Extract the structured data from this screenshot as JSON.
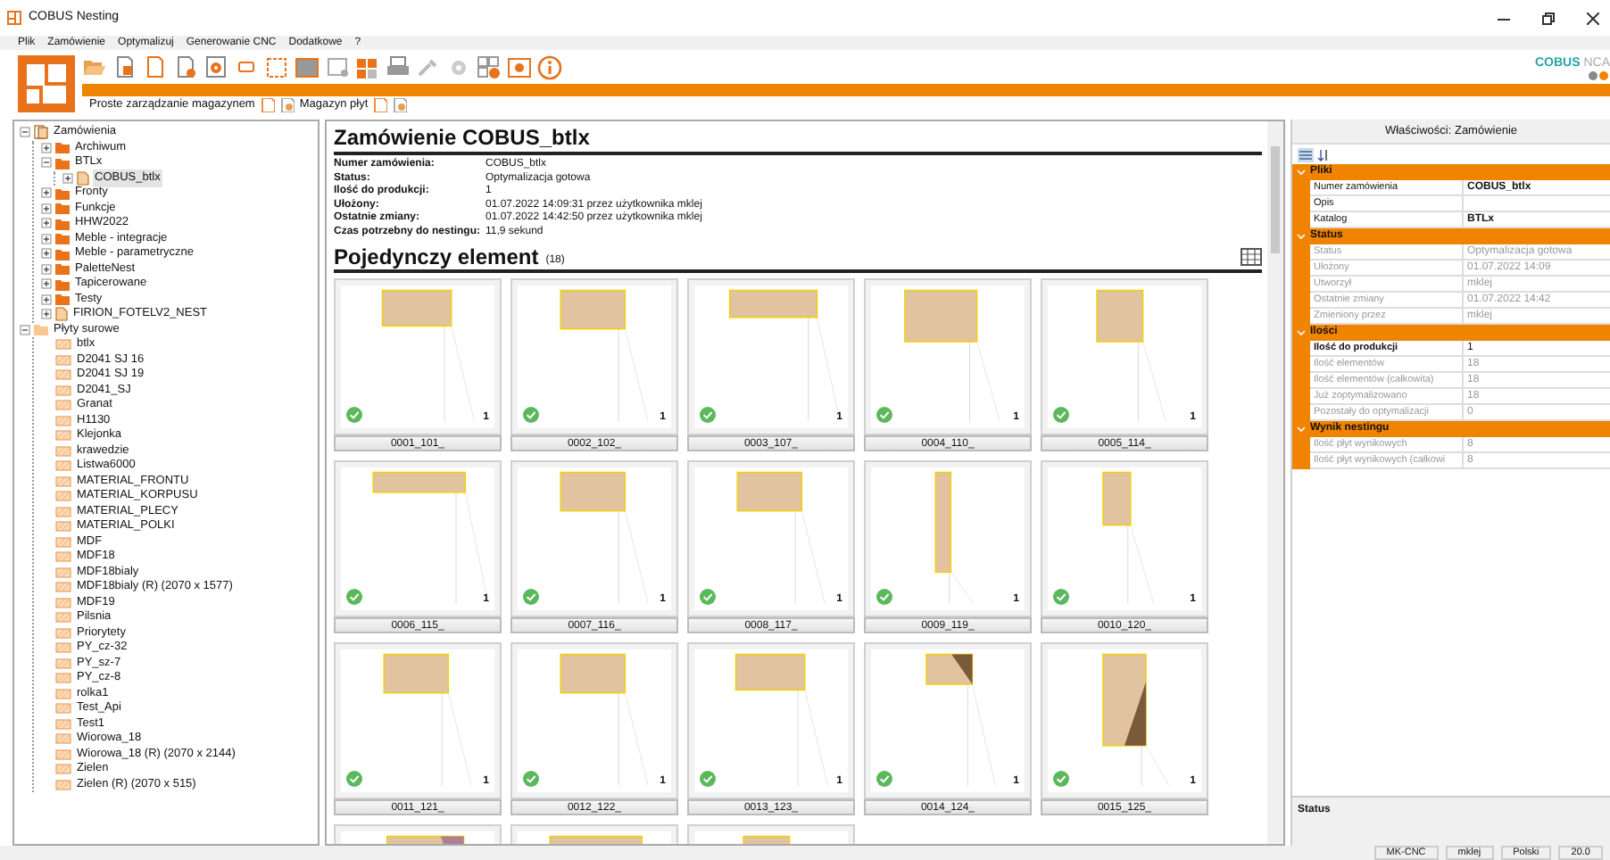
{
  "window": {
    "title": "COBUS Nesting"
  },
  "menu": [
    "Plik",
    "Zamówienie",
    "Optymalizuj",
    "Generowanie CNC",
    "Dodatkowe",
    "?"
  ],
  "brand": {
    "primary": "COBUS",
    "secondary": "NCA"
  },
  "subtoolbar": [
    {
      "label": "Proste zarządzanie magazynem"
    },
    {
      "label": "Magazyn płyt"
    }
  ],
  "tree": [
    {
      "label": "Zamówienia",
      "kind": "orders",
      "expanded": true,
      "selected": false,
      "children": [
        {
          "label": "Archiwum",
          "kind": "folder",
          "expanded": false,
          "selected": false
        },
        {
          "label": "BTLx",
          "kind": "folder",
          "expanded": true,
          "selected": false,
          "children": [
            {
              "label": "COBUS_btlx",
              "kind": "order",
              "expanded": false,
              "selected": true
            }
          ]
        },
        {
          "label": "Fronty",
          "kind": "folder",
          "expanded": false,
          "selected": false
        },
        {
          "label": "Funkcje",
          "kind": "folder",
          "expanded": false,
          "selected": false
        },
        {
          "label": "HHW2022",
          "kind": "folder",
          "expanded": false,
          "selected": false
        },
        {
          "label": "Meble - integracje",
          "kind": "folder",
          "expanded": false,
          "selected": false
        },
        {
          "label": "Meble - parametryczne",
          "kind": "folder",
          "expanded": false,
          "selected": false
        },
        {
          "label": "PaletteNest",
          "kind": "folder",
          "expanded": false,
          "selected": false
        },
        {
          "label": "Tapicerowane",
          "kind": "folder",
          "expanded": false,
          "selected": false
        },
        {
          "label": "Testy",
          "kind": "folder",
          "expanded": false,
          "selected": false
        },
        {
          "label": "FIRION_FOTELV2_NEST",
          "kind": "order",
          "expanded": false,
          "selected": false
        }
      ]
    },
    {
      "label": "Płyty surowe",
      "kind": "plates",
      "expanded": true,
      "selected": false,
      "children": [
        {
          "label": "btlx",
          "kind": "plate",
          "selected": false
        },
        {
          "label": "D2041 SJ 16",
          "kind": "plate",
          "selected": false
        },
        {
          "label": "D2041 SJ 19",
          "kind": "plate",
          "selected": false
        },
        {
          "label": "D2041_SJ",
          "kind": "plate",
          "selected": false
        },
        {
          "label": "Granat",
          "kind": "plate",
          "selected": false
        },
        {
          "label": "H1130",
          "kind": "plate",
          "selected": false
        },
        {
          "label": "Klejonka",
          "kind": "plate",
          "selected": false
        },
        {
          "label": "krawedzie",
          "kind": "plate",
          "selected": false
        },
        {
          "label": "Listwa6000",
          "kind": "plate",
          "selected": false
        },
        {
          "label": "MATERIAL_FRONTU",
          "kind": "plate",
          "selected": false
        },
        {
          "label": "MATERIAL_KORPUSU",
          "kind": "plate",
          "selected": false
        },
        {
          "label": "MATERIAL_PLECY",
          "kind": "plate",
          "selected": false
        },
        {
          "label": "MATERIAL_POLKI",
          "kind": "plate",
          "selected": false
        },
        {
          "label": "MDF",
          "kind": "plate",
          "selected": false
        },
        {
          "label": "MDF18",
          "kind": "plate",
          "selected": false
        },
        {
          "label": "MDF18bialy",
          "kind": "plate",
          "selected": false
        },
        {
          "label": "MDF18bialy (R) (2070 x 1577)",
          "kind": "plate",
          "selected": false
        },
        {
          "label": "MDF19",
          "kind": "plate",
          "selected": false
        },
        {
          "label": "Pilsnia",
          "kind": "plate",
          "selected": false
        },
        {
          "label": "Priorytety",
          "kind": "plate",
          "selected": false
        },
        {
          "label": "PY_cz-32",
          "kind": "plate",
          "selected": false
        },
        {
          "label": "PY_sz-7",
          "kind": "plate",
          "selected": false
        },
        {
          "label": "PY_cz-8",
          "kind": "plate",
          "selected": false
        },
        {
          "label": "rolka1",
          "kind": "plate",
          "selected": false
        },
        {
          "label": "Test_Api",
          "kind": "plate",
          "selected": false
        },
        {
          "label": "Test1",
          "kind": "plate",
          "selected": false
        },
        {
          "label": "Wiorowa_18",
          "kind": "plate",
          "selected": false
        },
        {
          "label": "Wiorowa_18 (R) (2070 x 2144)",
          "kind": "plate",
          "selected": false
        },
        {
          "label": "Zielen",
          "kind": "plate",
          "selected": false
        },
        {
          "label": "Zielen (R) (2070 x 515)",
          "kind": "plate",
          "selected": false
        }
      ]
    }
  ],
  "order": {
    "title": "Zamówienie COBUS_btlx",
    "fields": [
      {
        "label": "Numer zamówienia:",
        "value": "COBUS_btlx"
      },
      {
        "label": "Status:",
        "value": "Optymalizacja gotowa"
      },
      {
        "label": "Ilość do produkcji:",
        "value": "1"
      },
      {
        "label": "Ułożony:",
        "value": "01.07.2022 14:09:31 przez użytkownika mklej"
      },
      {
        "label": "Ostatnie zmiany:",
        "value": "01.07.2022 14:42:50 przez użytkownika mklej"
      },
      {
        "label": "Czas potrzebny do nestingu:",
        "value": "11,9 sekund"
      }
    ],
    "section": "Pojedynczy element",
    "section_count": "(18)"
  },
  "elements": [
    {
      "name": "0001_101_",
      "count": "1",
      "done": true,
      "kind": "wide"
    },
    {
      "name": "0002_102_",
      "count": "1",
      "done": true,
      "kind": "medium"
    },
    {
      "name": "0003_107_",
      "count": "1",
      "done": true,
      "kind": "broad"
    },
    {
      "name": "0004_110_",
      "count": "1",
      "done": true,
      "kind": "deep"
    },
    {
      "name": "0005_114_",
      "count": "1",
      "done": true,
      "kind": "slim"
    },
    {
      "name": "0006_115_",
      "count": "1",
      "done": true,
      "kind": "flat"
    },
    {
      "name": "0007_116_",
      "count": "1",
      "done": true,
      "kind": "medium"
    },
    {
      "name": "0008_117_",
      "count": "1",
      "done": true,
      "kind": "medium"
    },
    {
      "name": "0009_119_",
      "count": "1",
      "done": true,
      "kind": "narrow"
    },
    {
      "name": "0010_120_",
      "count": "1",
      "done": true,
      "kind": "strip"
    },
    {
      "name": "0011_121_",
      "count": "1",
      "done": true,
      "kind": "medium"
    },
    {
      "name": "0012_122_",
      "count": "1",
      "done": true,
      "kind": "medium"
    },
    {
      "name": "0013_123_",
      "count": "1",
      "done": true,
      "kind": "wide"
    },
    {
      "name": "0014_124_",
      "count": "1",
      "done": true,
      "kind": "cut"
    },
    {
      "name": "0015_125_",
      "count": "1",
      "done": true,
      "kind": "wedge"
    },
    {
      "kind": "corner"
    },
    {
      "kind": "flat"
    },
    {
      "kind": "slim"
    }
  ],
  "properties": {
    "title": "Właściwości: Zamówienie",
    "categories": [
      {
        "name": "Pliki",
        "expanded": true,
        "rows": [
          {
            "name": "Numer zamówienia",
            "value": "COBUS_btlx",
            "disabled": false,
            "bold_name": false,
            "bold_value": true
          },
          {
            "name": "Opis",
            "disabled": false,
            "bold_name": false,
            "bold_value": false
          },
          {
            "name": "Katalog",
            "value": "BTLx",
            "disabled": false,
            "bold_name": false,
            "bold_value": true
          }
        ]
      },
      {
        "name": "Status",
        "expanded": true,
        "rows": [
          {
            "name": "Status",
            "value": "Optymalizacja gotowa",
            "disabled": true,
            "bold_name": false,
            "bold_value": false
          },
          {
            "name": "Ułożony",
            "value": "01.07.2022 14:09",
            "disabled": true,
            "bold_name": false,
            "bold_value": false
          },
          {
            "name": "Utworzył",
            "value": "mklej",
            "disabled": true,
            "bold_name": false,
            "bold_value": false
          },
          {
            "name": "Ostatnie zmiany",
            "value": "01.07.2022 14:42",
            "disabled": true,
            "bold_name": false,
            "bold_value": false
          },
          {
            "name": "Zmieniony przez",
            "value": "mklej",
            "disabled": true,
            "bold_name": false,
            "bold_value": false
          }
        ]
      },
      {
        "name": "Ilości",
        "expanded": true,
        "rows": [
          {
            "name": "Ilość do produkcji",
            "value": "1",
            "disabled": false,
            "bold_name": true,
            "bold_value": false
          },
          {
            "name": "Ilość elementów",
            "value": "18",
            "disabled": true,
            "bold_name": false,
            "bold_value": false
          },
          {
            "name": "Ilość elementów (całkowita)",
            "value": "18",
            "disabled": true,
            "bold_name": false,
            "bold_value": false
          },
          {
            "name": "Już zoptymalizowano",
            "value": "18",
            "disabled": true,
            "bold_name": false,
            "bold_value": false
          },
          {
            "name": "Pozostały do optymalizacji",
            "value": "0",
            "disabled": true,
            "bold_name": false,
            "bold_value": false
          }
        ]
      },
      {
        "name": "Wynik nestingu",
        "expanded": true,
        "rows": [
          {
            "name": "Ilość płyt wynikowych",
            "value": "8",
            "disabled": true,
            "bold_name": false,
            "bold_value": false
          },
          {
            "name": "Ilość płyt wynikowych (całkowi",
            "value": "8",
            "disabled": true,
            "bold_name": false,
            "bold_value": false
          }
        ]
      }
    ]
  },
  "status_panel": {
    "title": "Status"
  },
  "status_bar": [
    "MK-CNC",
    "mklej",
    "Polski",
    "20.0"
  ]
}
